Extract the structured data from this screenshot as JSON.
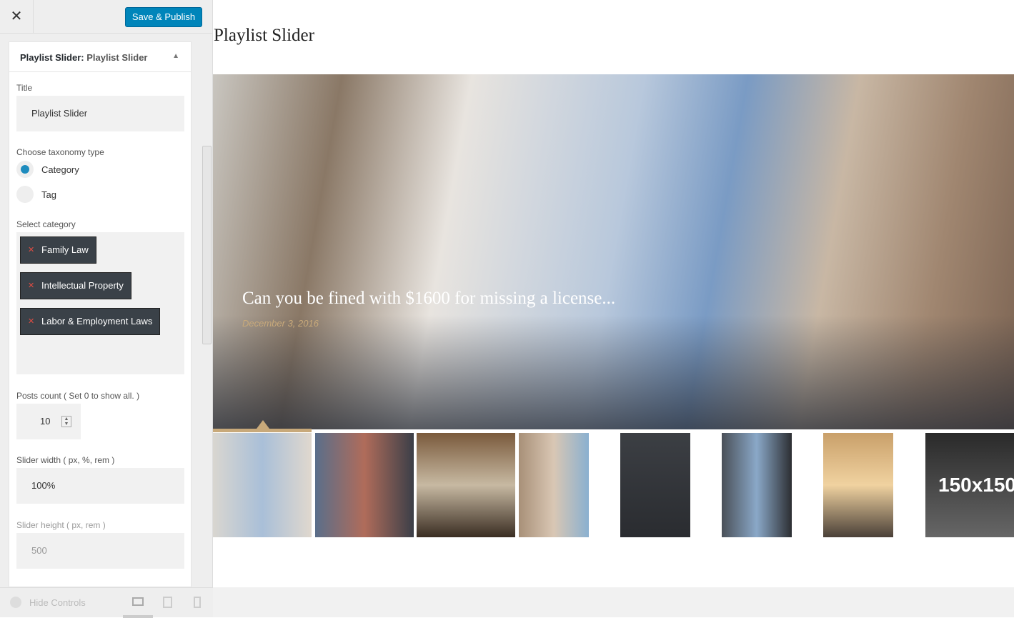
{
  "topbar": {
    "close_label": "✕",
    "publish_label": "Save & Publish"
  },
  "panel": {
    "widget_type": "Playlist Slider:",
    "widget_name": "Playlist Slider",
    "title_label": "Title",
    "title_value": "Playlist Slider",
    "taxonomy_label": "Choose taxonomy type",
    "taxonomy_options": [
      "Category",
      "Tag"
    ],
    "taxonomy_selected": "Category",
    "category_label": "Select category",
    "categories": [
      "Family Law",
      "Intellectual Property",
      "Labor & Employment Laws"
    ],
    "posts_count_label": "Posts count ( Set 0 to show all. )",
    "posts_count_value": "10",
    "width_label": "Slider width ( px, %, rem )",
    "width_value": "100%",
    "height_label": "Slider height ( px, rem )",
    "height_value": "500"
  },
  "bottombar": {
    "hide_label": "Hide Controls"
  },
  "preview": {
    "title": "Playlist Slider",
    "slide_title": "Can you be fined with $1600 for missing a license...",
    "slide_date": "December 3, 2016",
    "placeholder_thumb_text": "150x150"
  }
}
